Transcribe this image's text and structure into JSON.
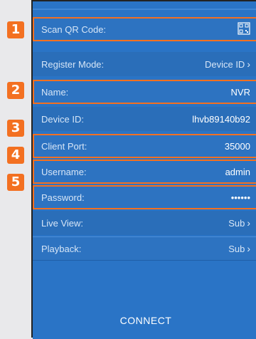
{
  "rows": {
    "scan": {
      "label": "Scan QR Code:",
      "icon": "qr-code-icon"
    },
    "register": {
      "label": "Register Mode:",
      "value": "Device ID"
    },
    "name": {
      "label": "Name:",
      "value": "NVR"
    },
    "device_id": {
      "label": "Device ID:",
      "value": "lhvb89140b92"
    },
    "port": {
      "label": "Client Port:",
      "value": "35000"
    },
    "username": {
      "label": "Username:",
      "value": "admin"
    },
    "password": {
      "label": "Password:",
      "value": "••••••"
    },
    "live_view": {
      "label": "Live View:",
      "value": "Sub"
    },
    "playback": {
      "label": "Playback:",
      "value": "Sub"
    }
  },
  "badges": [
    "1",
    "2",
    "3",
    "4",
    "5"
  ],
  "connect_label": "CONNECT",
  "colors": {
    "background": "#2a74c6",
    "highlight": "#f37021"
  }
}
